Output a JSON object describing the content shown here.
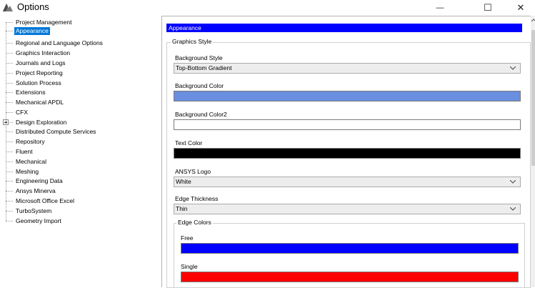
{
  "window": {
    "title": "Options",
    "minimize_glyph": "—",
    "maximize_glyph": "☐",
    "close_glyph": "✕"
  },
  "tree": {
    "items": [
      {
        "label": "Project Management",
        "selected": false
      },
      {
        "label": "Appearance",
        "selected": true
      },
      {
        "label": "Regional and Language Options",
        "selected": false
      },
      {
        "label": "Graphics Interaction",
        "selected": false
      },
      {
        "label": "Journals and Logs",
        "selected": false
      },
      {
        "label": "Project Reporting",
        "selected": false
      },
      {
        "label": "Solution Process",
        "selected": false
      },
      {
        "label": "Extensions",
        "selected": false
      },
      {
        "label": "Mechanical APDL",
        "selected": false
      },
      {
        "label": "CFX",
        "selected": false
      },
      {
        "label": "Design Exploration",
        "selected": false,
        "expandable": true
      },
      {
        "label": "Distributed Compute Services",
        "selected": false
      },
      {
        "label": "Repository",
        "selected": false
      },
      {
        "label": "Fluent",
        "selected": false
      },
      {
        "label": "Mechanical",
        "selected": false
      },
      {
        "label": "Meshing",
        "selected": false
      },
      {
        "label": "Engineering Data",
        "selected": false
      },
      {
        "label": "Ansys Minerva",
        "selected": false
      },
      {
        "label": "Microsoft Office Excel",
        "selected": false
      },
      {
        "label": "TurboSystem",
        "selected": false
      },
      {
        "label": "Geometry Import",
        "selected": false
      }
    ]
  },
  "panel": {
    "header": "Appearance",
    "graphics_style": {
      "legend": "Graphics Style",
      "background_style": {
        "label": "Background Style",
        "value": "Top-Bottom Gradient"
      },
      "background_color": {
        "label": "Background Color",
        "color": "#6a8ee0"
      },
      "background_color2": {
        "label": "Background Color2",
        "color": "#ffffff"
      },
      "text_color": {
        "label": "Text Color",
        "color": "#000000"
      },
      "ansys_logo": {
        "label": "ANSYS Logo",
        "value": "White"
      },
      "edge_thickness": {
        "label": "Edge Thickness",
        "value": "Thin"
      },
      "edge_colors": {
        "legend": "Edge Colors",
        "free": {
          "label": "Free",
          "color": "#0000ff"
        },
        "single": {
          "label": "Single",
          "color": "#ff0000"
        }
      }
    }
  },
  "colors": {
    "selection": "#0078d7",
    "header_bg": "#0000ff"
  },
  "icons": {
    "app": "ansys-options-icon",
    "dropdown": "chevron-down-icon"
  }
}
